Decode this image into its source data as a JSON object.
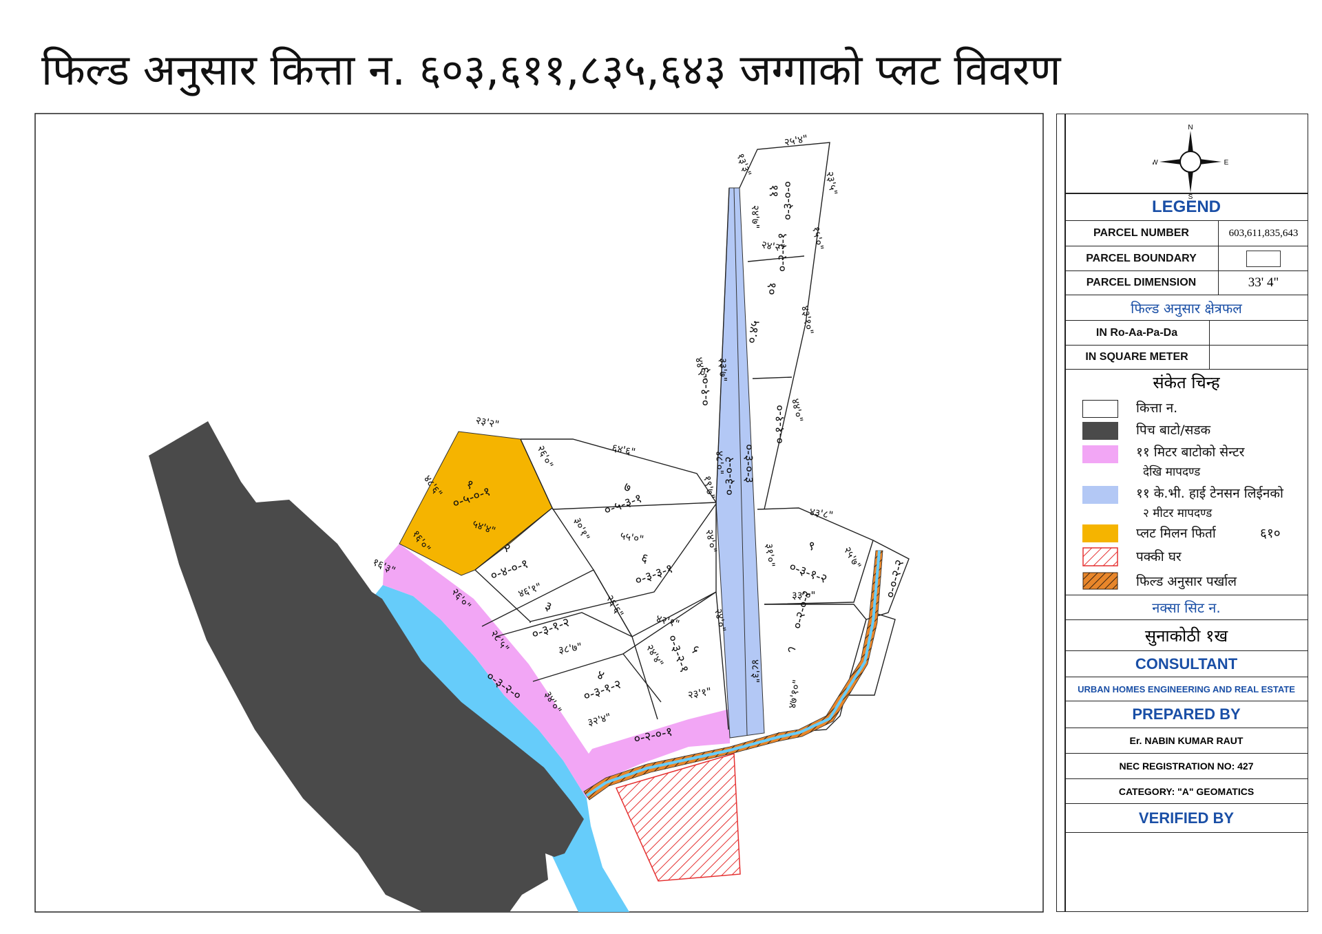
{
  "title": "फिल्ड अनुसार कित्ता न. ६०३,६११,८३५,६४३ जग्गाको प्लट विवरण",
  "compass": {
    "n": "N",
    "s": "S",
    "e": "E",
    "w": "W"
  },
  "legend": {
    "heading": "LEGEND",
    "parcel_number_label": "PARCEL NUMBER",
    "parcel_number_value": "603,611,835,643",
    "parcel_boundary_label": "PARCEL BOUNDARY",
    "parcel_dimension_label": "PARCEL DIMENSION",
    "parcel_dimension_value": "33' 4\"",
    "field_area_heading": "फिल्ड अनुसार क्षेत्रफल",
    "ropani_label": "IN Ro-Aa-Pa-Da",
    "sqm_label": "IN SQUARE METER",
    "symbols_heading": "संकेत चिन्ह",
    "symbols": [
      {
        "label": "कित्ता न.",
        "color": "#ffffff"
      },
      {
        "label": "पिच बाटो/सडक",
        "color": "#4a4a4a"
      },
      {
        "label": "११ मिटर बाटोको सेन्टर",
        "label2": "देखि मापदण्ड",
        "color": "#f2a6f5"
      },
      {
        "label": "११ के.भी. हाई टेनसन लिईनको",
        "label2": "२ मीटर मापदण्ड",
        "color": "#b3c8f5"
      },
      {
        "label": "प्लट मिलन फिर्ता",
        "extra": "६१०",
        "color": "#f5b400"
      },
      {
        "label": "पक्की घर",
        "color": "#e53030"
      },
      {
        "label": "फिल्ड अनुसार पर्खाल",
        "color": "#e8862a"
      }
    ],
    "sheet_heading": "नक्सा सिट न.",
    "sheet_value": "सुनाकोठी १ख",
    "consultant_heading": "CONSULTANT",
    "consultant_value": "URBAN HOMES ENGINEERING AND REAL ESTATE",
    "prepared_heading": "PREPARED BY",
    "prepared_name": "Er. NABIN KUMAR RAUT",
    "nec_reg": "NEC REGISTRATION NO:  427",
    "category": "CATEGORY:  \"A\" GEOMATICS",
    "verified_heading": "VERIFIED BY"
  },
  "colors": {
    "road": "#4a4a4a",
    "river": "#66ccfa",
    "road_setback": "#f2a6f5",
    "hv_setback": "#b3c8f5",
    "plot_return": "#f5b400",
    "house": "#e53030",
    "wall": "#e8862a",
    "heading_blue": "#1a4fa6"
  },
  "plots": [
    {
      "id": "1",
      "number": "१",
      "area": "०-५-०-१"
    },
    {
      "id": "2",
      "number": "२",
      "area": "०-४-०-१"
    },
    {
      "id": "3",
      "number": "३",
      "area": "०-३-१-२"
    },
    {
      "id": "4",
      "number": "४",
      "area": "०-३-१-२"
    },
    {
      "id": "5",
      "number": "५",
      "area": "०-३-२-१"
    },
    {
      "id": "6",
      "number": "६",
      "area": "०-३-३-१"
    },
    {
      "id": "7",
      "number": "७",
      "area": "०-५-३-१"
    },
    {
      "id": "8",
      "number": "८",
      "area": "०-२-०-२"
    },
    {
      "id": "9",
      "number": "९",
      "area": "०-३-१-२"
    },
    {
      "id": "10",
      "number": "१०",
      "area": "०-२-२-१"
    },
    {
      "id": "11",
      "number": "११",
      "area": "०-३-०-०"
    },
    {
      "id": "road-a",
      "area": "०-३-२-०"
    },
    {
      "id": "road-b",
      "area": "०-२-०-१"
    },
    {
      "id": "hv-a",
      "area": "०-३-०-२"
    },
    {
      "id": "hv-b",
      "area": "०-३-०-३"
    },
    {
      "id": "wall-plot",
      "area": "०-०-२-२"
    },
    {
      "id": "upper-left",
      "area": "०-१-०-३"
    },
    {
      "id": "mid-right",
      "area": "०-१-१-०"
    },
    {
      "id": "small-right",
      "area": "०.४५"
    }
  ],
  "dimensions": [
    "२५'४\"",
    "१३'३\"",
    "२३'५\"",
    "१५'०\"",
    "२४'२\"",
    "२४'७\"",
    "४३'१०\"",
    "४४'२\"",
    "४४'०\"",
    "३३'७\"",
    "२३'२\"",
    "६४'६\"",
    "२६'०\"",
    "४८'६\"",
    "१६'०\"",
    "५४'४\"",
    "१६'३\"",
    "३०'१\"",
    "५५'०\"",
    "१९'७\"",
    "४६'१\"",
    "२६'०\"",
    "२६'६\"",
    "२४'०\"",
    "४२'१\"",
    "२८'५\"",
    "३८'७\"",
    "२४'४\"",
    "२४'०\"",
    "३४'०\"",
    "३२'४\"",
    "२३'१\"",
    "४३'८\"",
    "२५'७\"",
    "३१'०\"",
    "३३'०\"",
    "४८'३\"",
    "४७'१०\"",
    "४८'०\""
  ]
}
